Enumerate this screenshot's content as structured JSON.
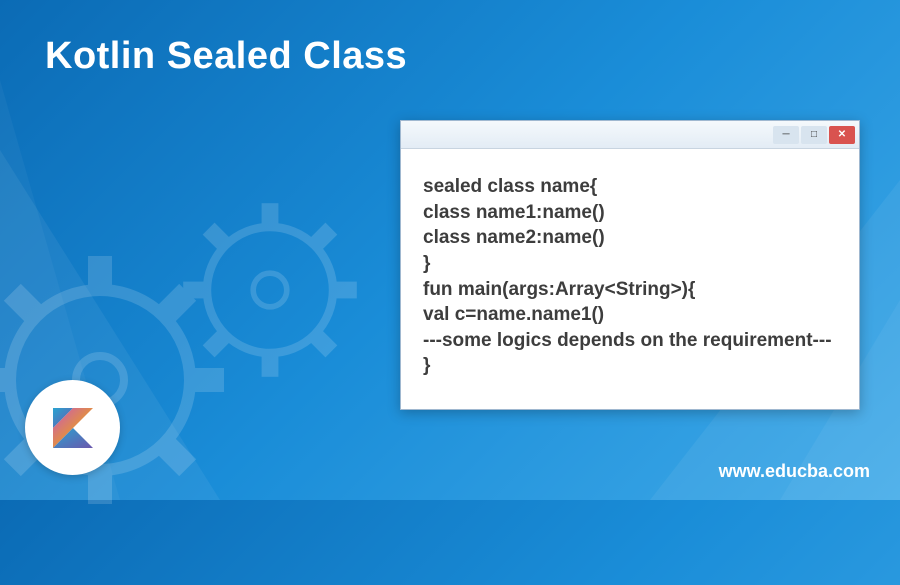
{
  "title": "Kotlin Sealed Class",
  "code": {
    "line1": "sealed class name{",
    "line2": "class name1:name()",
    "line3": "class name2:name()",
    "line4": "}",
    "line5": "fun main(args:Array<String>){",
    "line6": "val c=name.name1()",
    "line7": "---some logics depends on the requirement---",
    "line8": "}"
  },
  "footer_url": "www.educba.com",
  "icons": {
    "logo": "kotlin-logo",
    "gear": "gear-icon"
  }
}
